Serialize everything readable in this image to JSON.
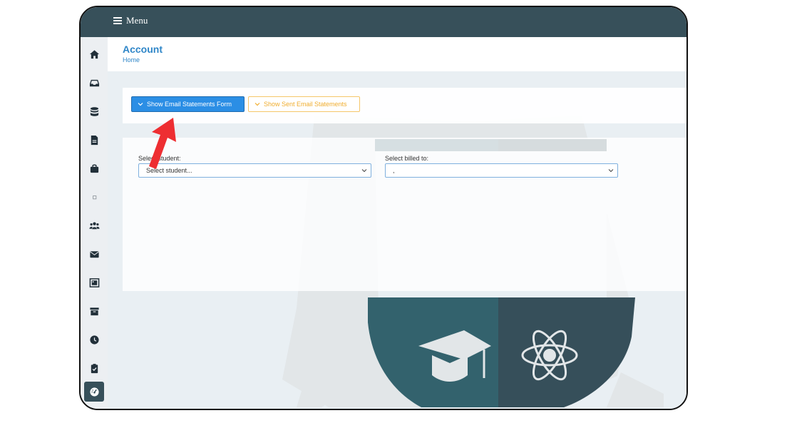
{
  "topbar": {
    "menu_label": "Menu"
  },
  "sidebar": {
    "items": [
      {
        "icon": "home-icon"
      },
      {
        "icon": "inbox-icon"
      },
      {
        "icon": "database-icon"
      },
      {
        "icon": "document-icon"
      },
      {
        "icon": "briefcase-icon"
      },
      {
        "icon": "square-icon"
      },
      {
        "icon": "users-icon"
      },
      {
        "icon": "envelope-icon"
      },
      {
        "icon": "gallery-icon"
      },
      {
        "icon": "archive-icon"
      },
      {
        "icon": "clock-icon"
      },
      {
        "icon": "clipboard-check-icon"
      },
      {
        "icon": "dashboard-icon"
      }
    ]
  },
  "header": {
    "title": "Account",
    "breadcrumb": "Home"
  },
  "actions": {
    "show_form_label": "Show Email Statements Form",
    "show_sent_label": "Show Sent Email Statements"
  },
  "form": {
    "student_label": "Select student:",
    "student_value": "Select student...",
    "billed_label": "Select billed to:",
    "billed_value": ","
  },
  "colors": {
    "topbar": "#37505a",
    "primary": "#2b8ee5",
    "warning": "#f0ad2e",
    "link": "#2f86c8",
    "annotation_arrow": "#ee2e32"
  }
}
